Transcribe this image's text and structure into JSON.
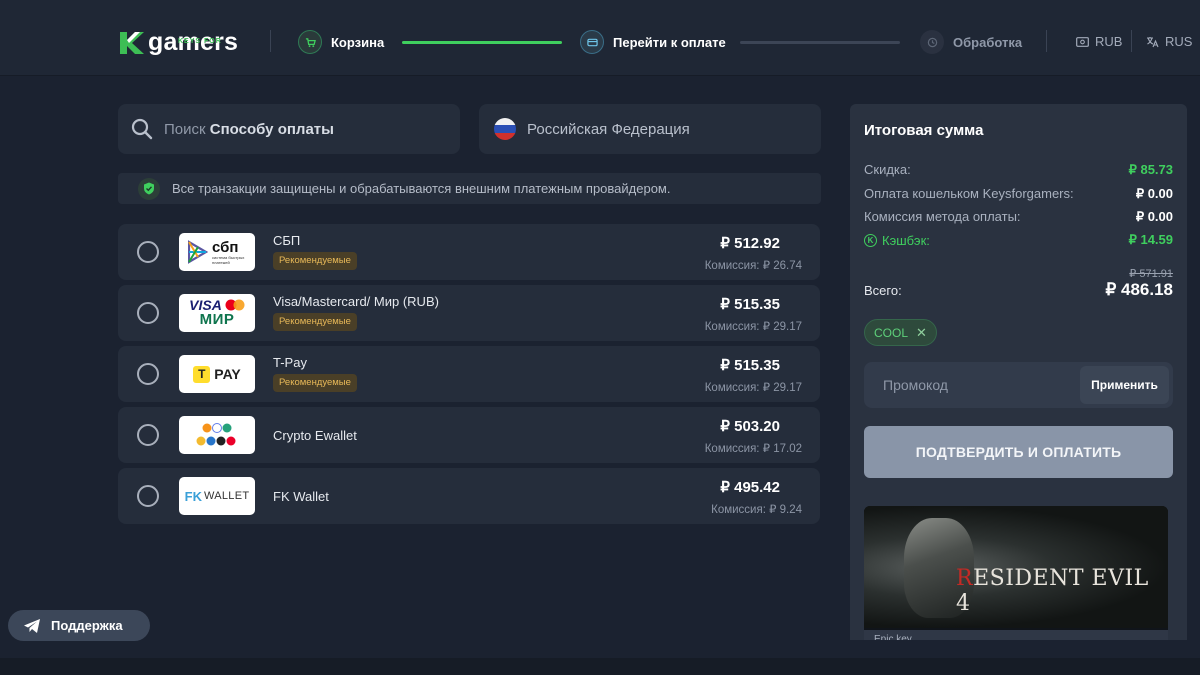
{
  "brand": {
    "name": "gamers",
    "tagline": "KEYS FOR"
  },
  "steps": [
    {
      "label": "Корзина",
      "state": "done"
    },
    {
      "label": "Перейти к оплате",
      "state": "current"
    },
    {
      "label": "Обработка",
      "state": "pending"
    }
  ],
  "header": {
    "currency": "RUB",
    "language": "RUS"
  },
  "search": {
    "prefix": "Поиск",
    "term": "Способу оплаты"
  },
  "country": {
    "value": "Российская Федерация"
  },
  "notice": "Все транзакции защищены и обрабатываются внешним платежным провайдером.",
  "methods": [
    {
      "name": "СБП",
      "badge": "Рекомендуемые",
      "price": "₽ 512.92",
      "fee": "Комиссия: ₽ 26.74",
      "logo": "sbp-logo"
    },
    {
      "name": "Visa/Mastercard/ Мир (RUB)",
      "badge": "Рекомендуемые",
      "price": "₽ 515.35",
      "fee": "Комиссия: ₽ 29.17",
      "logo": "visa-mir-logo"
    },
    {
      "name": "T-Pay",
      "badge": "Рекомендуемые",
      "price": "₽ 515.35",
      "fee": "Комиссия: ₽ 29.17",
      "logo": "tpay-logo"
    },
    {
      "name": "Crypto Ewallet",
      "badge": "",
      "price": "₽ 503.20",
      "fee": "Комиссия: ₽ 17.02",
      "logo": "crypto-logo"
    },
    {
      "name": "FK Wallet",
      "badge": "",
      "price": "₽ 495.42",
      "fee": "Комиссия: ₽ 9.24",
      "logo": "fk-wallet-logo"
    }
  ],
  "logos": {
    "sbp": {
      "big": "сбп",
      "small": "система быстрых платежей"
    },
    "visa": "VISA",
    "mir": "МИР",
    "tpay": "PAY",
    "fk": "WALLET"
  },
  "summary": {
    "title": "Итоговая сумма",
    "rows": [
      {
        "label": "Скидка:",
        "value": "₽ 85.73"
      },
      {
        "label": "Оплата кошельком Keysforgamers:",
        "value": "₽ 0.00"
      },
      {
        "label": "Комиссия метода оплаты:",
        "value": "₽ 0.00"
      },
      {
        "label": "Кэшбэк:",
        "value": "₽ 14.59"
      }
    ],
    "old_total": "₽ 571.91",
    "total_label": "Всего:",
    "total": "₽ 486.18",
    "coupon": "COOL",
    "promo_placeholder": "Промокод",
    "apply_label": "Применить",
    "pay_label": "ПОДТВЕРДИТЬ И ОПЛАТИТЬ"
  },
  "product": {
    "title_first": "R",
    "title_rest": "ESIDENT EVIL 4",
    "foot": "Epic key"
  },
  "support": "Поддержка",
  "colors": {
    "accent_green": "#3fcf5e",
    "badge": "#e7b858",
    "bg": "#1b2230",
    "panel": "#252d3b"
  }
}
